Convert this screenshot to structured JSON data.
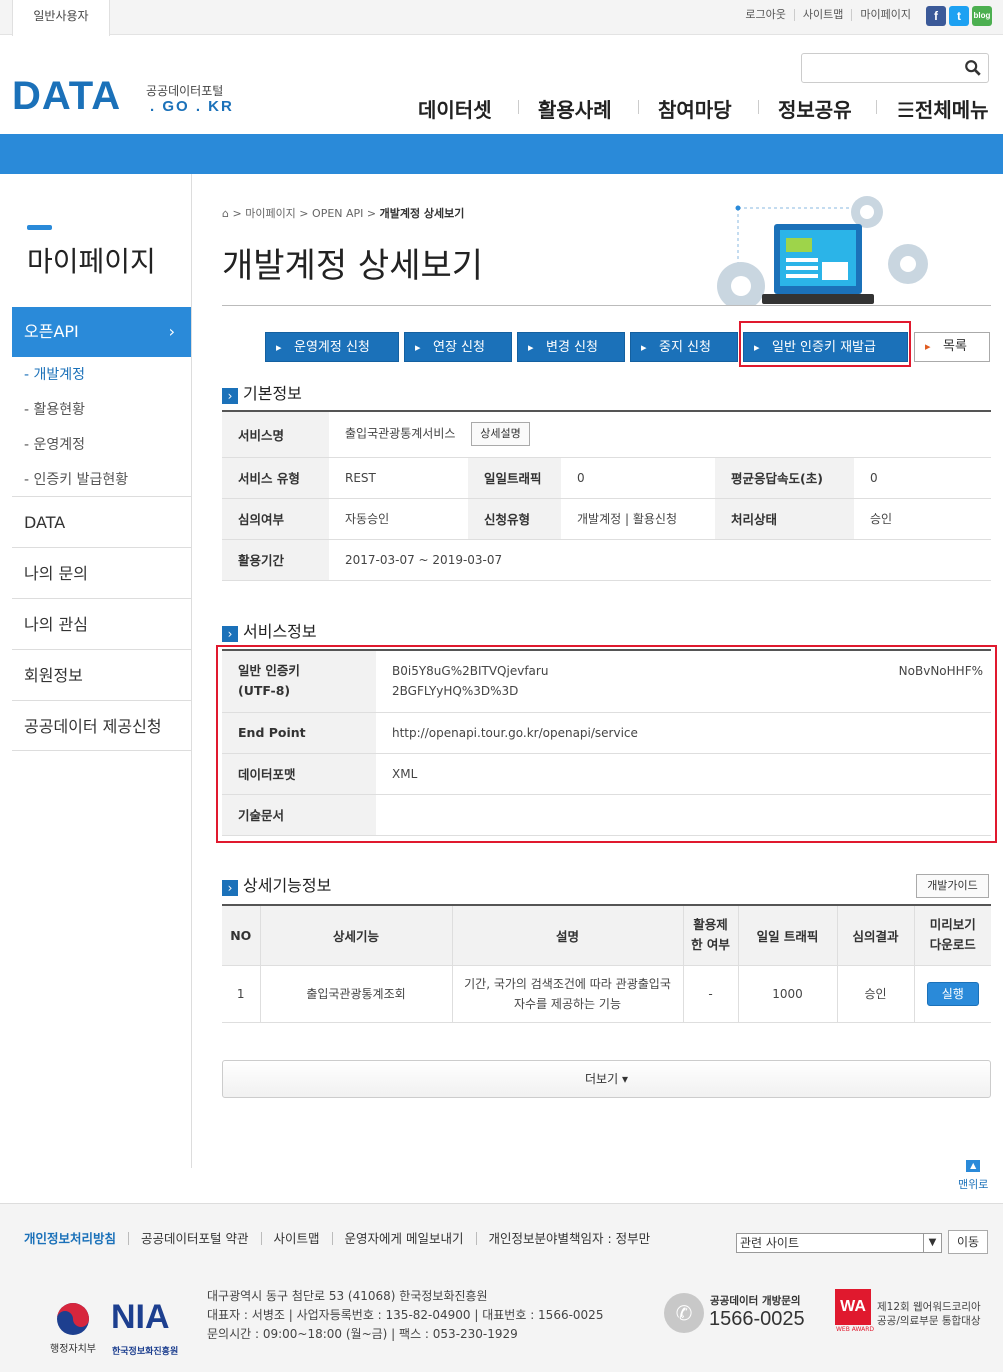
{
  "topbar": {
    "user_tab": "일반사용자",
    "links": [
      "로그아웃",
      "사이트맵",
      "마이페이지"
    ],
    "sns_icons": [
      "facebook-icon",
      "twitter-icon",
      "blog-icon"
    ]
  },
  "header": {
    "logo_main": "DATA",
    "logo_sub1": "공공데이터포털",
    "logo_sub2": ". GO . KR",
    "search_placeholder": "",
    "nav": [
      "데이터셋",
      "활용사례",
      "참여마당",
      "정보공유",
      "☰전체메뉴"
    ]
  },
  "sidebar": {
    "title": "마이페이지",
    "active": "오픈API",
    "subitems": [
      "- 개발계정",
      "- 활용현황",
      "- 운영계정",
      "- 인증키 발급현황"
    ],
    "items": [
      "DATA",
      "나의 문의",
      "나의 관심",
      "회원정보",
      "공공데이터 제공신청"
    ]
  },
  "breadcrumb": {
    "level1": "마이페이지",
    "level2": "OPEN API",
    "current": "개발계정 상세보기"
  },
  "page_title": "개발계정 상세보기",
  "actions": [
    "운영계정 신청",
    "연장 신청",
    "변경 신청",
    "중지 신청",
    "일반 인증키 재발급"
  ],
  "list_button": "목록",
  "basic_info": {
    "heading": "기본정보",
    "service_name_label": "서비스명",
    "service_name": "출입국관광통계서비스",
    "detail_button": "상세설명",
    "service_type_label": "서비스 유형",
    "service_type": "REST",
    "daily_traffic_label": "일일트래픽",
    "daily_traffic": "0",
    "avg_response_label": "평균응답속도(초)",
    "avg_response": "0",
    "review_label": "심의여부",
    "review": "자동승인",
    "apply_type_label": "신청유형",
    "apply_type": "개발계정 | 활용신청",
    "status_label": "처리상태",
    "status": "승인",
    "period_label": "활용기간",
    "period": "2017-03-07 ~ 2019-03-07"
  },
  "service_info": {
    "heading": "서비스정보",
    "key_label_1": "일반 인증키",
    "key_label_2": "(UTF-8)",
    "key_line1_left": "B0i5Y8uG%2BITVQjevfaru",
    "key_line1_right": "NoBvNoHHF%",
    "key_line2": "2BGFLYyHQ%3D%3D",
    "endpoint_label": "End Point",
    "endpoint": "http://openapi.tour.go.kr/openapi/service",
    "format_label": "데이터포맷",
    "format": "XML",
    "docs_label": "기술문서",
    "docs": ""
  },
  "detail_info": {
    "heading": "상세기능정보",
    "guide_button": "개발가이드",
    "columns": [
      "NO",
      "상세기능",
      "설명",
      "활용제\n한 여부",
      "일일 트래픽",
      "심의결과",
      "미리보기\n다운로드"
    ],
    "rows": [
      {
        "no": "1",
        "name": "출입국관광통계조회",
        "desc_1": "기간, 국가의 검색조건에 따라 관광출입국",
        "desc_2": "자수를 제공하는 기능",
        "limit": "-",
        "traffic": "1000",
        "result": "승인",
        "action": "실행"
      }
    ]
  },
  "more_button": "더보기 ▾",
  "top_button": "맨위로",
  "footer": {
    "links": [
      "개인정보처리방침",
      "공공데이터포털 약관",
      "사이트맵",
      "운영자에게 메일보내기",
      "개인정보분야별책임자 : 정부만"
    ],
    "related_site": "관련 사이트",
    "go_button": "이동",
    "address_1": "대구광역시 동구 첨단로 53 (41068) 한국정보화진흥원",
    "address_2": "대표자 : 서병조  | 사업자등록번호 : 135-82-04900  | 대표번호 : 1566-0025",
    "address_3": "문의시간 : 09:00~18:00 (월~금)  | 팩스 : 053-230-1929",
    "mois_label": "행정자치부",
    "nia_logo": "NIA",
    "nia_label": "한국정보화진흥원",
    "phone_label": "공공데이터 개방문의",
    "phone_number": "1566-0025",
    "wa_logo": "WA",
    "wa_sub": "WEB AWARD",
    "award_1": "제12회 웹어워드코리아",
    "award_2": "공공/의료부문 통합대상"
  },
  "colors": {
    "brand_blue": "#1b71b9",
    "band_blue": "#2a8ad9",
    "highlight_red": "#e0192e"
  }
}
